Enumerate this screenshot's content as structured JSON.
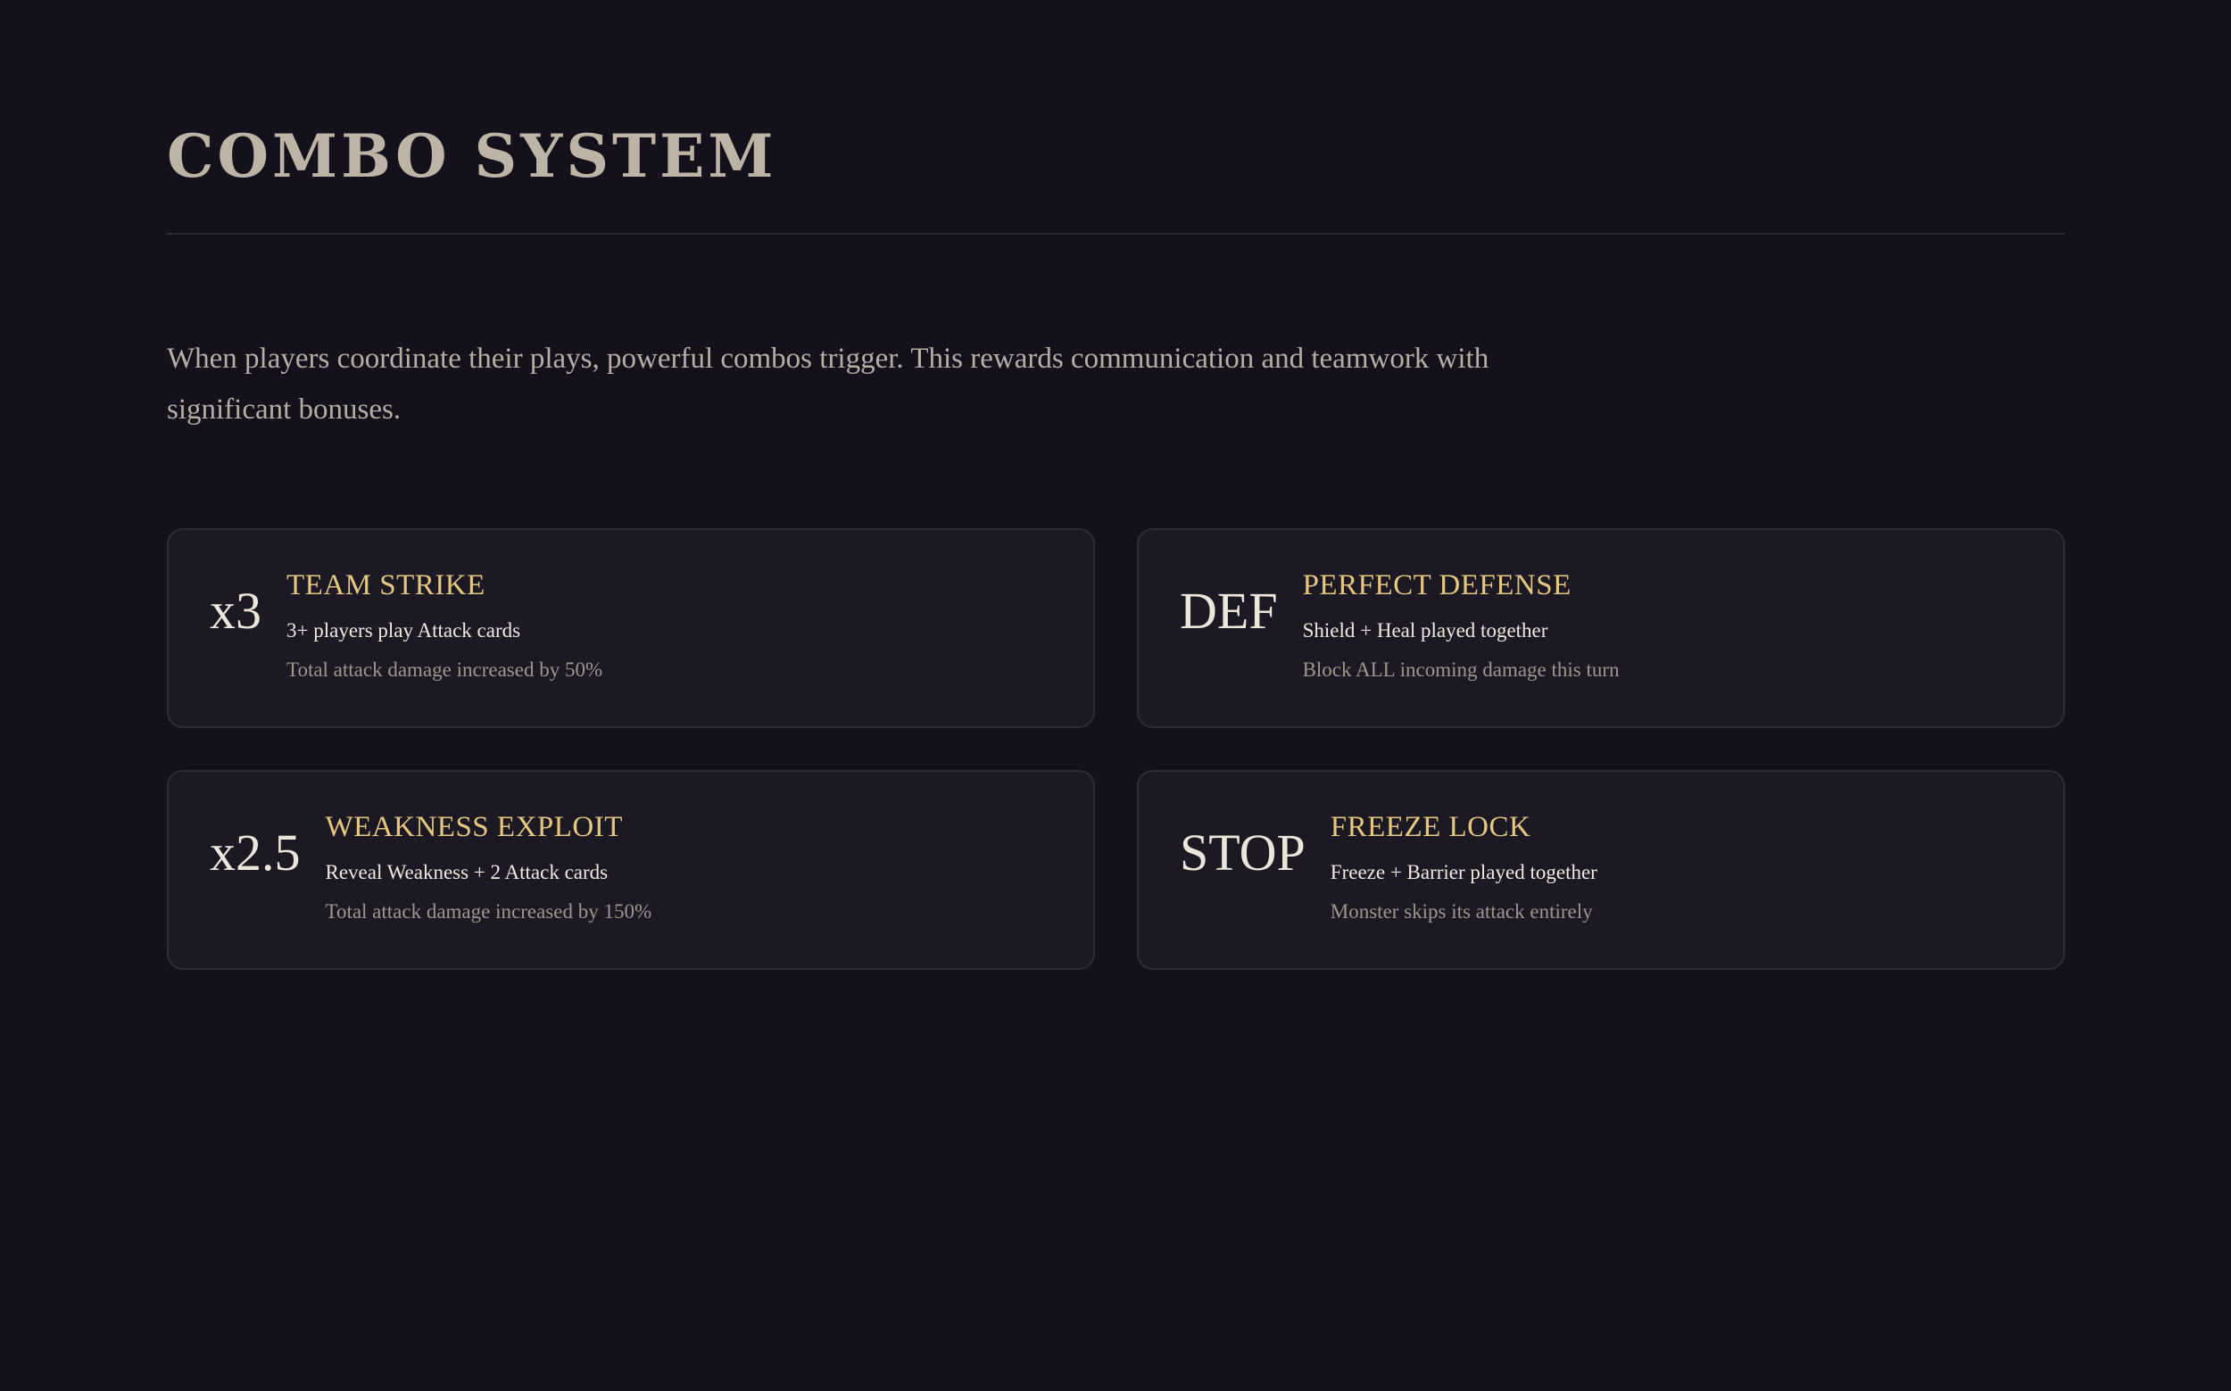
{
  "header": {
    "title": "Combo System"
  },
  "intro": {
    "text": "When players coordinate their plays, powerful combos trigger. This rewards communication and teamwork with significant bonuses."
  },
  "combos": [
    {
      "multiplier": "x3",
      "name": "Team Strike",
      "requirement": "3+ players play Attack cards",
      "effect": "Total attack damage increased by 50%"
    },
    {
      "multiplier": "DEF",
      "name": "Perfect Defense",
      "requirement": "Shield + Heal played together",
      "effect": "Block ALL incoming damage this turn"
    },
    {
      "multiplier": "x2.5",
      "name": "Weakness Exploit",
      "requirement": "Reveal Weakness + 2 Attack cards",
      "effect": "Total attack damage increased by 150%"
    },
    {
      "multiplier": "STOP",
      "name": "Freeze Lock",
      "requirement": "Freeze + Barrier played together",
      "effect": "Monster skips its attack entirely"
    }
  ],
  "colors": {
    "background": "#14101c",
    "card_background": "#1c1924",
    "accent_gold": "#e6c77f",
    "title": "#bdb4a6"
  }
}
